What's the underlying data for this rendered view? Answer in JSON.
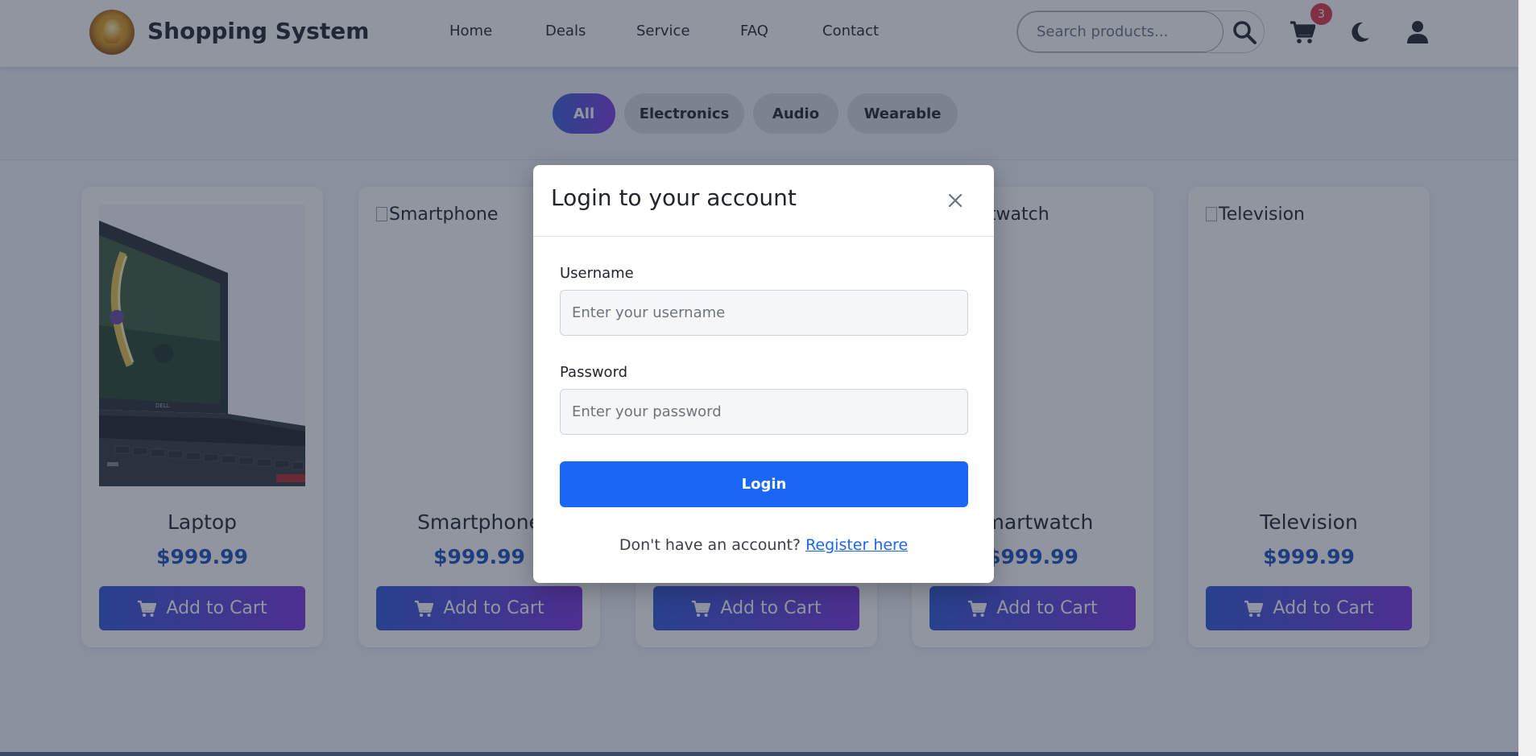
{
  "header": {
    "brand": "Shopping System",
    "nav": [
      "Home",
      "Deals",
      "Service",
      "FAQ",
      "Contact"
    ],
    "search": {
      "placeholder": "Search products..."
    },
    "cart_count": "3"
  },
  "filters": {
    "items": [
      "All",
      "Electronics",
      "Audio",
      "Wearable"
    ],
    "active": "All"
  },
  "products": [
    {
      "name": "Laptop",
      "price": "$999.99",
      "image_alt": "Laptop",
      "button": "Add to Cart"
    },
    {
      "name": "Smartphone",
      "price": "$999.99",
      "image_alt": "Smartphone",
      "button": "Add to Cart"
    },
    {
      "name": "",
      "price": "",
      "image_alt": "",
      "button": "Add to Cart"
    },
    {
      "name": "Smartwatch",
      "price": "$999.99",
      "image_alt": "Smartwatch",
      "button": "Add to Cart"
    },
    {
      "name": "Television",
      "price": "$999.99",
      "image_alt": "Television",
      "button": "Add to Cart"
    }
  ],
  "modal": {
    "title": "Login to your account",
    "username_label": "Username",
    "username_placeholder": "Enter your username",
    "password_label": "Password",
    "password_placeholder": "Enter your password",
    "login_button": "Login",
    "register_prompt": "Don't have an account?",
    "register_link": "Register here"
  },
  "colors": {
    "primary": "#1a66f5",
    "price": "#1a4fbf",
    "badge": "#dc3545",
    "gradient_start": "#2f57d6",
    "gradient_end": "#7a33dd"
  }
}
